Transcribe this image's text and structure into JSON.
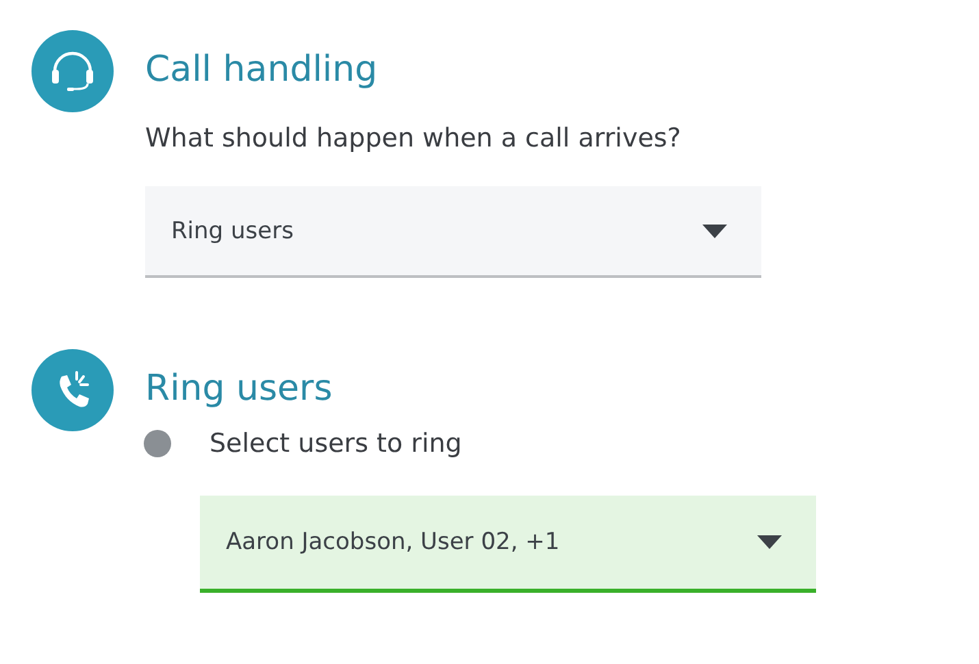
{
  "sections": [
    {
      "kind": "headset",
      "title": "Call handling",
      "question": "What should happen when a call arrives?",
      "dropdown": {
        "value": "Ring users",
        "valid": false
      }
    },
    {
      "kind": "phone",
      "title": "Ring users",
      "option": {
        "label": "Select users to ring",
        "color": "#8a8f94"
      },
      "dropdown": {
        "value": "Aaron Jacobson, User 02, +1",
        "valid": true
      }
    }
  ]
}
